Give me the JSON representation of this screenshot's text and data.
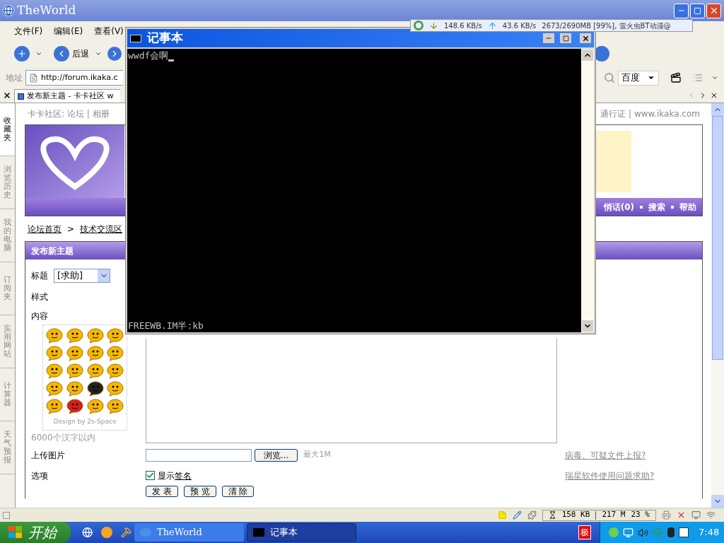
{
  "browser": {
    "title": "TheWorld",
    "menu": [
      "文件(F)",
      "编辑(E)",
      "查看(V)"
    ],
    "back_label": "后退",
    "address": {
      "label": "地址",
      "value": "http://forum.ikaka.c"
    },
    "search_engine": "百度",
    "tabs": [
      {
        "label": "发布新主题 - 卡卡社区 w",
        "selected": true
      }
    ],
    "sidebar": [
      {
        "label": "收藏夹",
        "selected": true
      },
      {
        "label": "浏览历史",
        "selected": false
      },
      {
        "label": "我的电脑",
        "selected": false
      },
      {
        "label": "订阅夹",
        "selected": false
      },
      {
        "label": "实用网站",
        "selected": false
      },
      {
        "label": "计算器",
        "selected": false
      },
      {
        "label": "天气预报",
        "selected": false
      }
    ]
  },
  "bt_monitor": {
    "download": "148.6 KB/s",
    "upload": "43.6 KB/s",
    "task": "2673/2690MB [99%], 萤火虫BT动漫@"
  },
  "page": {
    "top_left": "卡卡社区: 论坛 | 相册",
    "top_right": "通行证 | www.ikaka.com",
    "nav": [
      "悄话(0)",
      "搜索",
      "帮助"
    ],
    "breadcrumb": [
      "论坛首页",
      "技术交流区"
    ],
    "breadcrumb_sep": ">",
    "form": {
      "heading": "发布新主题",
      "title_label": "标题",
      "title_select": "[求助]",
      "style_label": "样式",
      "content_label": "内容",
      "emoticon_credit": "Design by 2s-Space",
      "limit_note": "6000个汉字以内",
      "upload_label": "上传图片",
      "browse_button": "浏览...",
      "max_size": "最大1M",
      "options_label": "选项",
      "signature": {
        "label": "显示",
        "link": "签名",
        "checked": true
      },
      "buttons": [
        "发 表",
        "预 览",
        "清 除"
      ],
      "help_links": [
        "病毒、可疑文件上报?",
        "瑞星软件使用问题求助?"
      ]
    }
  },
  "status_bar": {
    "cache": "158 KB",
    "memory": "217 M",
    "cpu": "23 %"
  },
  "console": {
    "title": "记事本",
    "lines": [
      "wwdf会啊"
    ],
    "ime_line": "FREEWB.IM半:kb"
  },
  "taskbar": {
    "start": "开始",
    "tasks": [
      {
        "label": "TheWorld",
        "selected": false
      },
      {
        "label": "记事本",
        "selected": true
      }
    ],
    "ime": "极",
    "clock": "7:48"
  }
}
